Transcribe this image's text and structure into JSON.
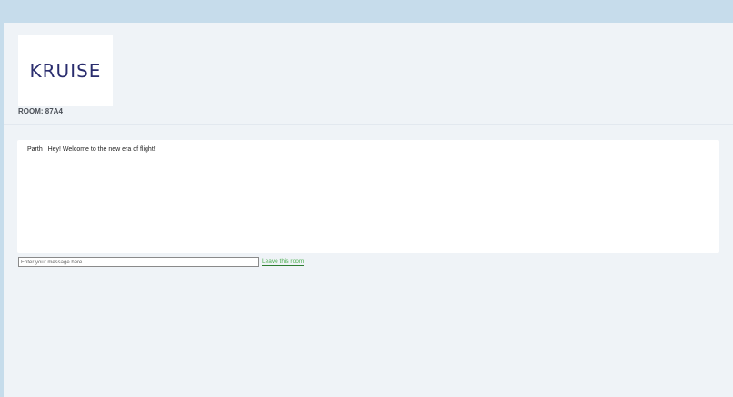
{
  "brand": {
    "logo_text": "KRUISE"
  },
  "room": {
    "label": "ROOM: 87A4"
  },
  "chat": {
    "messages": [
      {
        "text": "Parth : Hey! Welcome to the new era of flight!"
      }
    ]
  },
  "composer": {
    "input_value": "",
    "input_placeholder": "Enter your message here",
    "leave_label": "Leave this room"
  },
  "colors": {
    "page_background": "#c6dceb",
    "app_background": "#eff3f7",
    "logo_color": "#2a2d6e",
    "link_color": "#4caf50"
  }
}
